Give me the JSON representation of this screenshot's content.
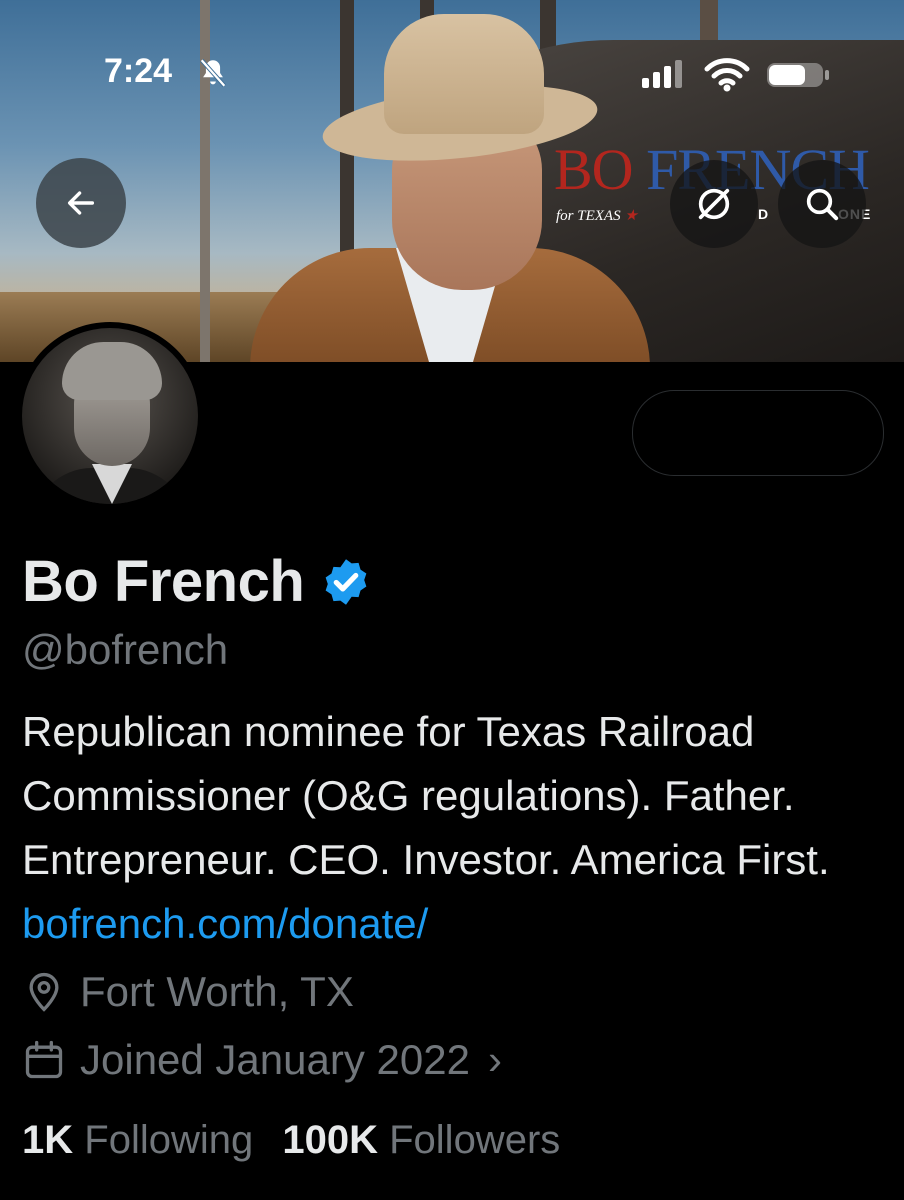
{
  "status_bar": {
    "time": "7:24",
    "icons": [
      "bell-slash-icon",
      "signal-icon",
      "wifi-icon",
      "battery-icon"
    ]
  },
  "banner": {
    "brand_first": "BO",
    "brand_second": "FRENCH",
    "brand_sub": "for TEXAS",
    "brand_tail": "ONE",
    "brand_mid": "D",
    "colors": {
      "brand_red": "#b3261e",
      "brand_blue": "#2f5aa8"
    }
  },
  "nav": {
    "back_icon": "arrow-left-icon",
    "grok_icon": "grok-icon",
    "search_icon": "search-icon"
  },
  "profile": {
    "name": "Bo French",
    "verified": true,
    "handle": "@bofrench",
    "bio_text": "Republican nominee for Texas Railroad Commissioner (O&G regulations). Father. Entrepreneur. CEO. Investor. America First.",
    "bio_link": "bofrench.com/donate/",
    "location": "Fort Worth, TX",
    "joined": "Joined January 2022",
    "joined_chevron": "›",
    "following_count": "1K",
    "following_label": "Following",
    "followers_count": "100K",
    "followers_label": "Followers"
  },
  "colors": {
    "background": "#000000",
    "text_primary": "#e7e9ea",
    "text_secondary": "#71767b",
    "link": "#1d9bf0",
    "verified_badge": "#1d9bf0"
  }
}
